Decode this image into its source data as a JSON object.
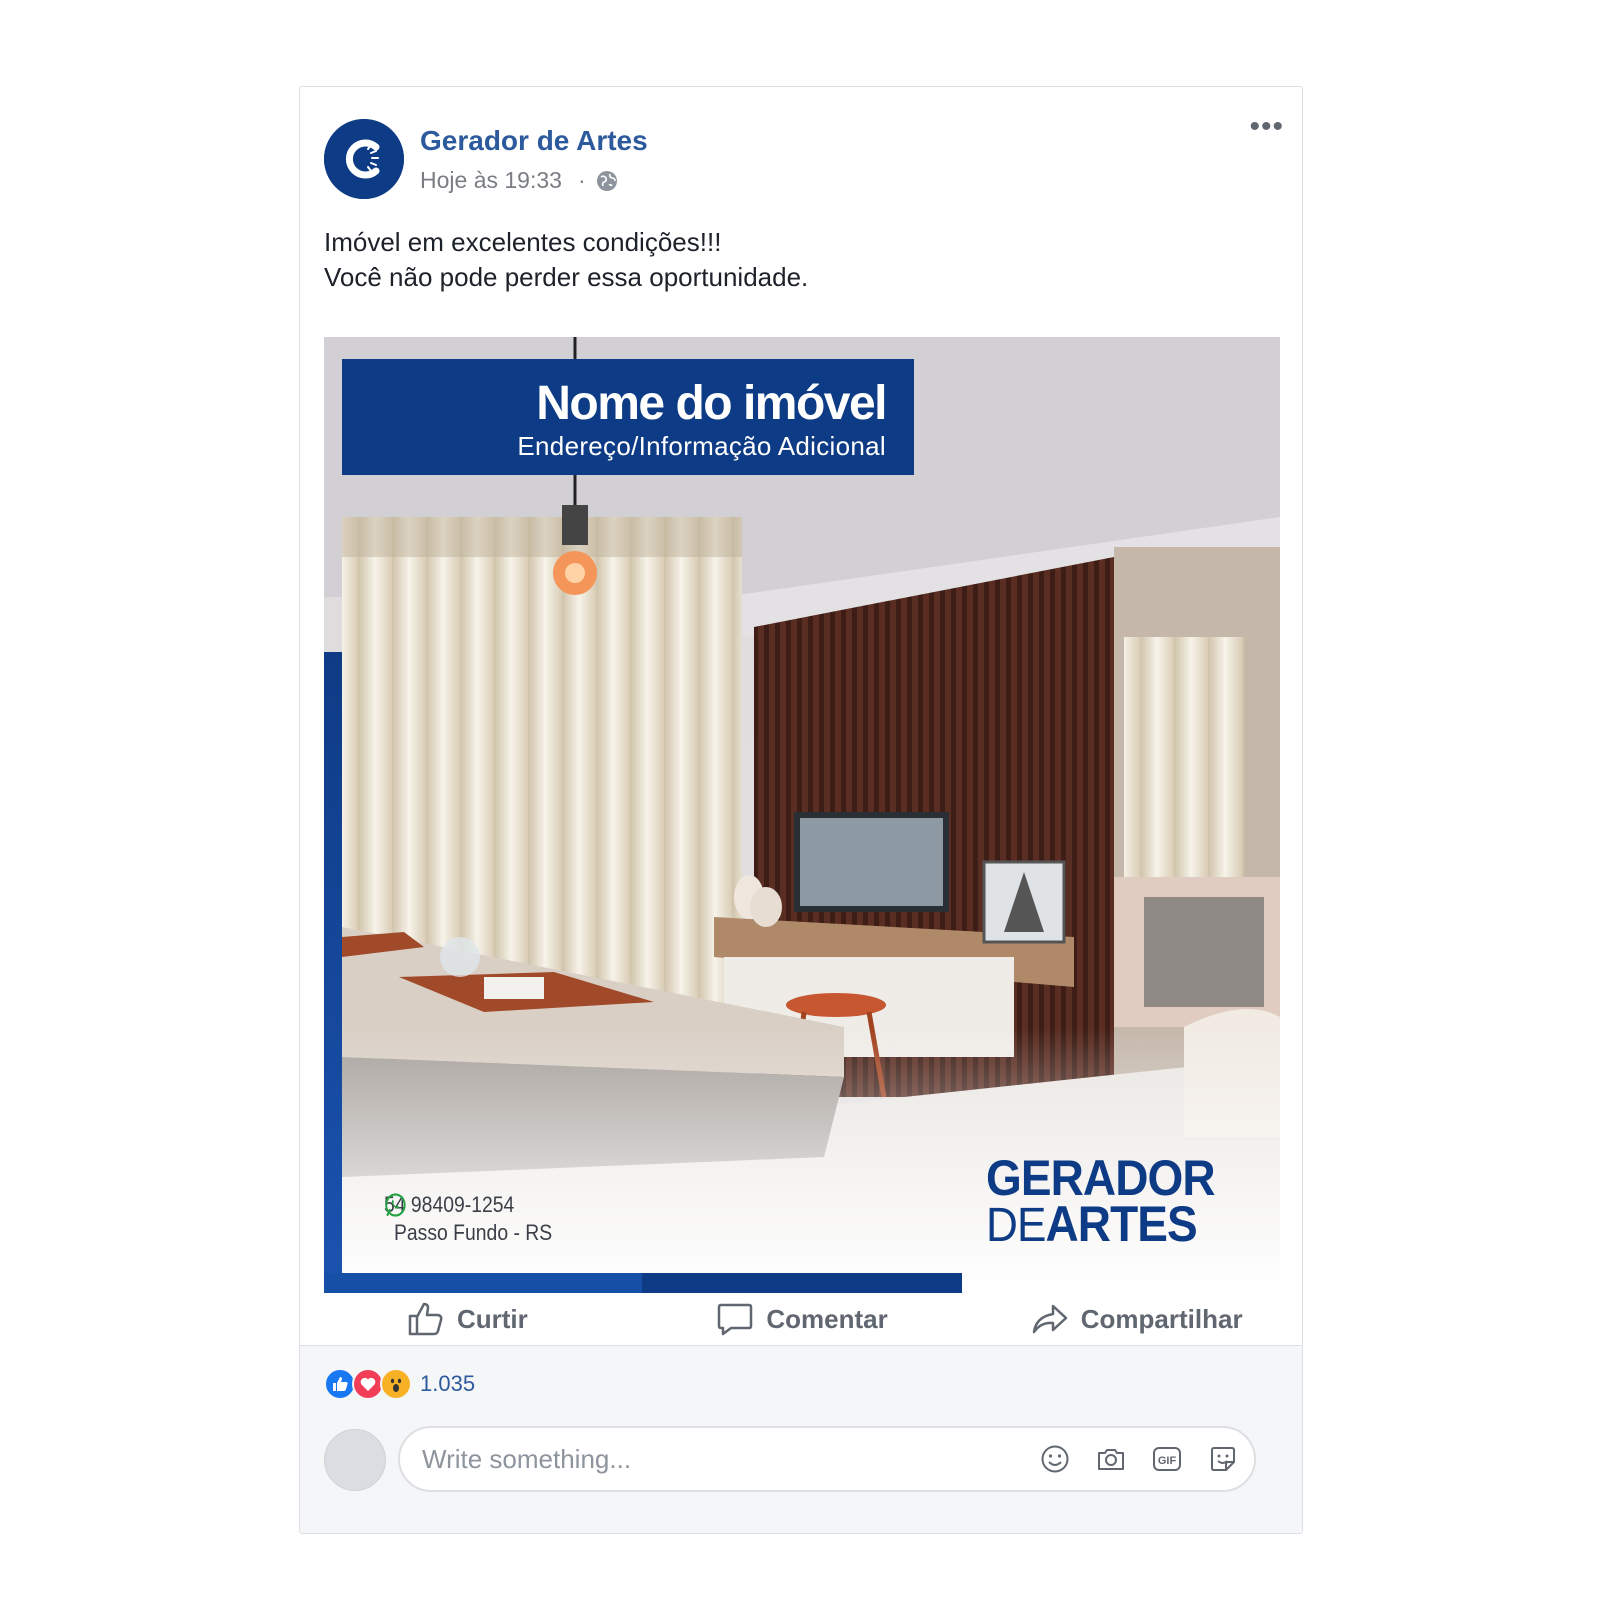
{
  "post": {
    "page_name": "Gerador de Artes",
    "timestamp": "Hoje às 19:33",
    "separator": "·",
    "more_label": "•••",
    "text_line1": "Imóvel em excelentes condições!!!",
    "text_line2": "Você não pode perder essa oportunidade."
  },
  "image": {
    "title": "Nome do imóvel",
    "subtitle": "Endereço/Informação Adicional",
    "phone": "54 98409-1254",
    "city": "Passo Fundo - RS",
    "brand_line1": "GERADOR",
    "brand_de": "DE",
    "brand_artes": "ARTES"
  },
  "actions": {
    "like": "Curtir",
    "comment": "Comentar",
    "share": "Compartilhar"
  },
  "reactions": {
    "count": "1.035",
    "types": [
      "like-icon",
      "love-icon",
      "wow-icon"
    ]
  },
  "comment": {
    "placeholder": "Write something...",
    "tools": [
      "emoji-icon",
      "camera-icon",
      "gif-icon",
      "sticker-icon"
    ]
  },
  "colors": {
    "brand_blue": "#0e3b85",
    "link_blue": "#2d5a9c",
    "like_blue": "#1877f2",
    "love_red": "#f33e58",
    "wow_yellow": "#f7b125"
  }
}
